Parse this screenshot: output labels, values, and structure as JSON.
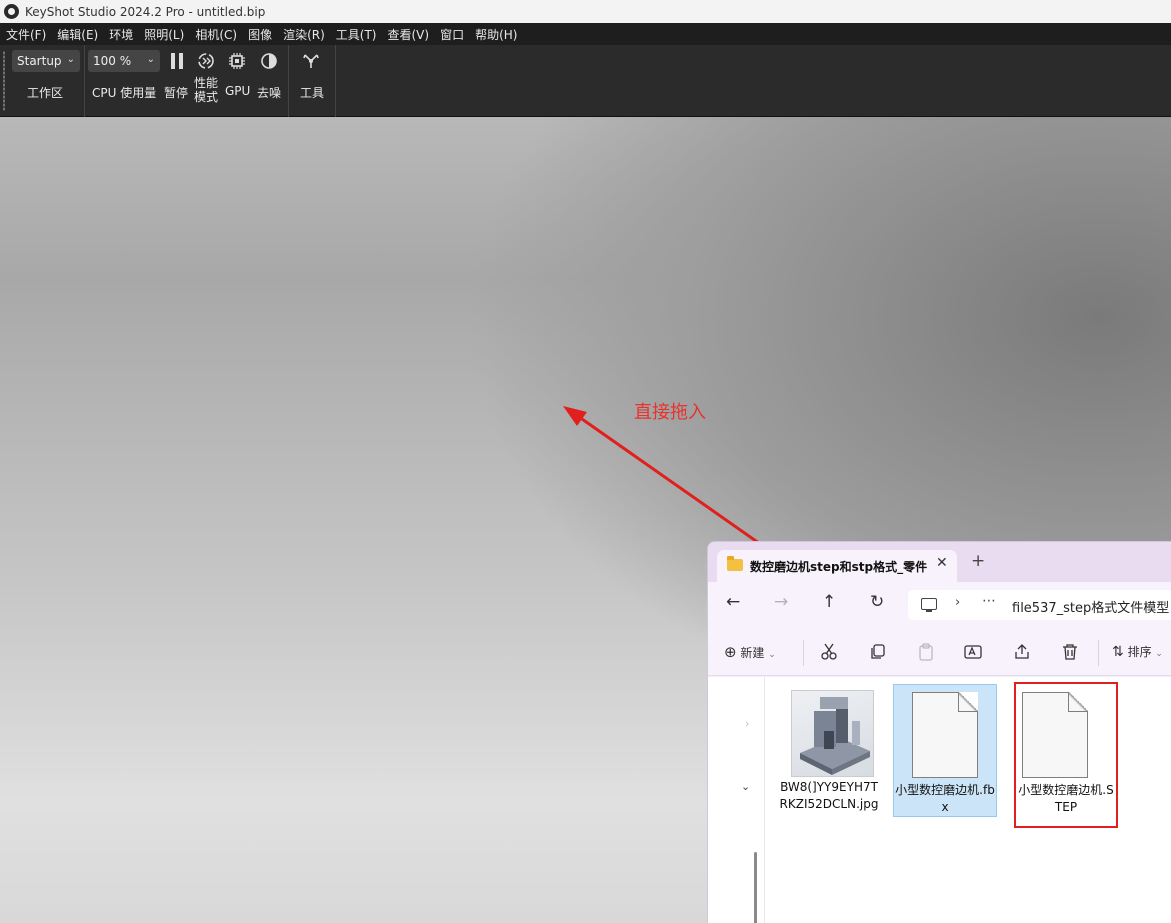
{
  "window": {
    "title": "KeyShot Studio 2024.2 Pro  - untitled.bip"
  },
  "menu": [
    "文件(F)",
    "编辑(E)",
    "环境",
    "照明(L)",
    "相机(C)",
    "图像",
    "渲染(R)",
    "工具(T)",
    "查看(V)",
    "窗口",
    "帮助(H)"
  ],
  "toolbar": {
    "workspace_value": "Startup",
    "workspace_label": "工作区",
    "zoom_value": "100 %",
    "cpu_label": "CPU 使用量",
    "pause_label": "暂停",
    "perf_label_1": "性能",
    "perf_label_2": "模式",
    "gpu_label": "GPU",
    "denoise_label": "去噪",
    "tools_label": "工具"
  },
  "annotation": {
    "text": "直接拖入",
    "color": "#e8322c"
  },
  "explorer": {
    "tab_title": "数控磨边机step和stp格式_零件",
    "address_path": "file537_step格式文件模型",
    "new_label": "新建",
    "sort_label": "排序",
    "files": [
      {
        "name": "BW8(]YY9EYH7TRKZI52DCLN.jpg",
        "type": "image"
      },
      {
        "name": "小型数控磨边机.fbx",
        "type": "document",
        "state": "selected"
      },
      {
        "name": "小型数控磨边机.STEP",
        "type": "document",
        "state": "highlighted"
      }
    ]
  }
}
